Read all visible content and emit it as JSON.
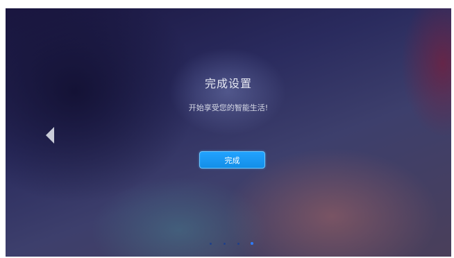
{
  "screen": {
    "title": "完成设置",
    "subtitle": "开始享受您的智能生活!",
    "done_button_label": "完成"
  },
  "pager": {
    "total_pages": 4,
    "active_page": 4
  },
  "icons": {
    "back": "left-triangle-arrow-icon"
  },
  "colors": {
    "button": "#1a98f5",
    "button_border": "#6cc8ff",
    "dot_inactive": "#1f3f8a",
    "dot_active": "#2f7cff"
  }
}
